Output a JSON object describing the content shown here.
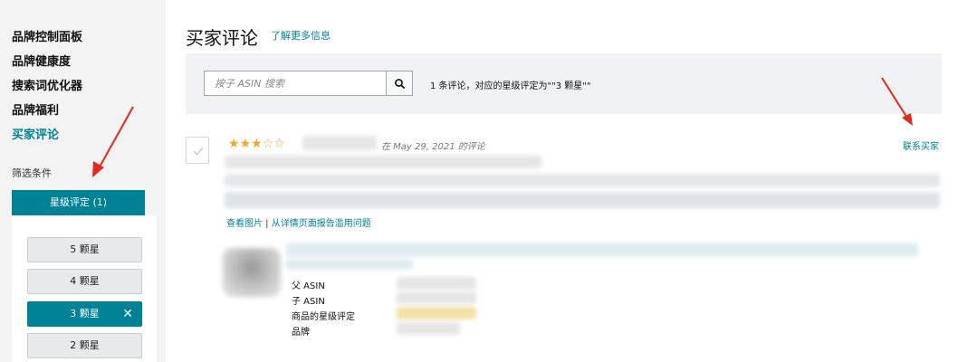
{
  "sidebar": {
    "items": [
      {
        "label": "品牌控制面板",
        "active": false
      },
      {
        "label": "品牌健康度",
        "active": false
      },
      {
        "label": "搜索词优化器",
        "active": false
      },
      {
        "label": "品牌福利",
        "active": false
      },
      {
        "label": "买家评论",
        "active": true
      }
    ],
    "filter_label": "筛选条件",
    "facet": {
      "header": "星级评定 (1)",
      "options": [
        {
          "label": "5 颗星",
          "selected": false
        },
        {
          "label": "4 颗星",
          "selected": false
        },
        {
          "label": "3 颗星",
          "selected": true
        },
        {
          "label": "2 颗星",
          "selected": false
        }
      ],
      "clear_symbol": "✕"
    }
  },
  "main": {
    "title": "买家评论",
    "learn_more": "了解更多信息",
    "search": {
      "placeholder": "按子 ASIN 搜索",
      "results_text": "1 条评论，对应的星级评定为\"\"3 颗星\"\""
    },
    "review": {
      "rating": 3,
      "date": "在 May 29, 2021 的评论",
      "contact": "联系买家",
      "link_view_images": "查看图片",
      "link_separator": " | ",
      "link_report": "从详情页面报告滥用问题",
      "meta": {
        "parent_asin": "父 ASIN",
        "child_asin": "子 ASIN",
        "product_rating": "商品的星级评定",
        "brand": "品牌"
      }
    }
  },
  "colors": {
    "accent": "#008296",
    "star": "#f5a623",
    "annotation": "#e32a1c"
  },
  "icons": {
    "search": "search-icon",
    "check": "checkmark-icon"
  }
}
